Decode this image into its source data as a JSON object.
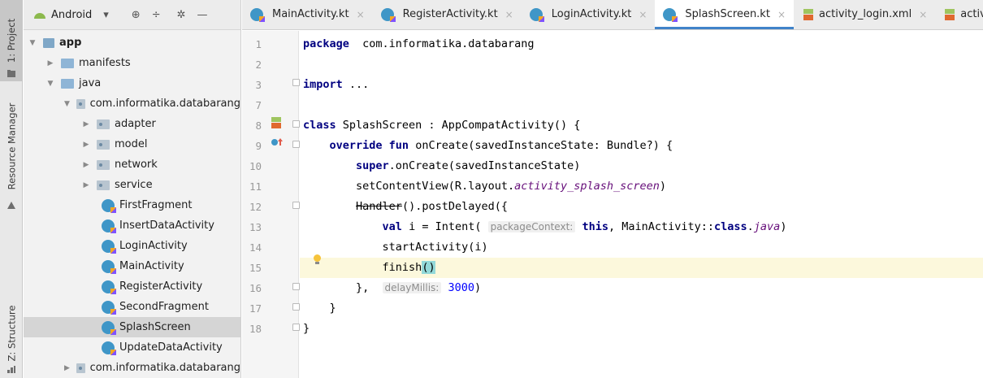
{
  "toolstrip": {
    "project_tab": "1: Project",
    "resource_tab": "Resource Manager",
    "structure_tab": "Z: Structure"
  },
  "project_panel": {
    "view_selector": "Android",
    "tree": [
      {
        "label": "app",
        "depth": 0,
        "kind": "module",
        "expanded": true
      },
      {
        "label": "manifests",
        "depth": 1,
        "kind": "folder",
        "expanded": false
      },
      {
        "label": "java",
        "depth": 1,
        "kind": "folder",
        "expanded": true
      },
      {
        "label": "com.informatika.databarang",
        "depth": 2,
        "kind": "package",
        "expanded": true
      },
      {
        "label": "adapter",
        "depth": 3,
        "kind": "package",
        "expanded": false
      },
      {
        "label": "model",
        "depth": 3,
        "kind": "package",
        "expanded": false
      },
      {
        "label": "network",
        "depth": 3,
        "kind": "package",
        "expanded": false
      },
      {
        "label": "service",
        "depth": 3,
        "kind": "package",
        "expanded": false
      },
      {
        "label": "FirstFragment",
        "depth": 3,
        "kind": "kotlin"
      },
      {
        "label": "InsertDataActivity",
        "depth": 3,
        "kind": "kotlin"
      },
      {
        "label": "LoginActivity",
        "depth": 3,
        "kind": "kotlin"
      },
      {
        "label": "MainActivity",
        "depth": 3,
        "kind": "kotlin"
      },
      {
        "label": "RegisterActivity",
        "depth": 3,
        "kind": "kotlin"
      },
      {
        "label": "SecondFragment",
        "depth": 3,
        "kind": "kotlin"
      },
      {
        "label": "SplashScreen",
        "depth": 3,
        "kind": "kotlin",
        "selected": true
      },
      {
        "label": "UpdateDataActivity",
        "depth": 3,
        "kind": "kotlin"
      },
      {
        "label": "com.informatika.databarang",
        "depth": 2,
        "kind": "package",
        "expanded": false
      }
    ]
  },
  "tabs": [
    {
      "label": "MainActivity.kt",
      "icon": "kotlin-file-icon",
      "active": false
    },
    {
      "label": "RegisterActivity.kt",
      "icon": "kotlin-file-icon",
      "active": false
    },
    {
      "label": "LoginActivity.kt",
      "icon": "kotlin-file-icon",
      "active": false
    },
    {
      "label": "SplashScreen.kt",
      "icon": "kotlin-file-icon",
      "active": true
    },
    {
      "label": "activity_login.xml",
      "icon": "xml-layout-icon",
      "active": false
    },
    {
      "label": "activity_r",
      "icon": "xml-layout-icon",
      "active": false
    }
  ],
  "editor": {
    "current_line": 15,
    "lines": [
      {
        "n": "1",
        "tokens": [
          [
            "kw",
            "package"
          ],
          [
            "",
            "  com.informatika.databarang"
          ]
        ]
      },
      {
        "n": "2",
        "tokens": []
      },
      {
        "n": "3",
        "tokens": [
          [
            "kw",
            "import"
          ],
          [
            "",
            ""
          ],
          [
            "dim",
            " ..."
          ]
        ]
      },
      {
        "n": "7",
        "tokens": []
      },
      {
        "n": "8",
        "tokens": [
          [
            "kw",
            "class"
          ],
          [
            "",
            " SplashScreen : AppCompatActivity() {"
          ]
        ]
      },
      {
        "n": "9",
        "tokens": [
          [
            "",
            "    "
          ],
          [
            "kw",
            "override fun"
          ],
          [
            "",
            " onCreate(savedInstanceState: Bundle?) {"
          ]
        ]
      },
      {
        "n": "10",
        "tokens": [
          [
            "",
            "        "
          ],
          [
            "kw",
            "super"
          ],
          [
            "",
            ".onCreate(savedInstanceState)"
          ]
        ]
      },
      {
        "n": "11",
        "tokens": [
          [
            "",
            "        setContentView(R.layout."
          ],
          [
            "it",
            "activity_splash_screen"
          ],
          [
            "",
            ")"
          ]
        ]
      },
      {
        "n": "12",
        "tokens": [
          [
            "",
            "        "
          ],
          [
            "strike",
            "Handler"
          ],
          [
            "",
            "().postDelayed({"
          ]
        ]
      },
      {
        "n": "13",
        "tokens": [
          [
            "",
            "            "
          ],
          [
            "kw",
            "val"
          ],
          [
            "",
            " i = Intent( "
          ],
          [
            "hint",
            "packageContext:"
          ],
          [
            "kw",
            " this"
          ],
          [
            "",
            ", MainActivity::"
          ],
          [
            "kw",
            "class"
          ],
          [
            "",
            "."
          ],
          [
            "it",
            "java"
          ],
          [
            "",
            ")"
          ]
        ]
      },
      {
        "n": "14",
        "tokens": [
          [
            "",
            "            startActivity(i)"
          ]
        ]
      },
      {
        "n": "15",
        "tokens": [
          [
            "",
            "            finish"
          ],
          [
            "paren",
            "()"
          ]
        ]
      },
      {
        "n": "16",
        "tokens": [
          [
            "",
            "        },  "
          ],
          [
            "hint",
            "delayMillis:"
          ],
          [
            "num",
            " 3000"
          ],
          [
            "",
            ")"
          ]
        ]
      },
      {
        "n": "17",
        "tokens": [
          [
            "",
            "    }"
          ]
        ]
      },
      {
        "n": "18",
        "tokens": [
          [
            "",
            "}"
          ]
        ]
      }
    ]
  }
}
